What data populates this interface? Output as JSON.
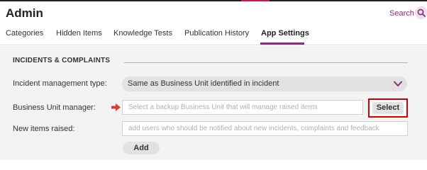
{
  "app": {
    "title": "Admin"
  },
  "header": {
    "search_label": "Search"
  },
  "tabs": [
    {
      "label": "Categories"
    },
    {
      "label": "Hidden Items"
    },
    {
      "label": "Knowledge Tests"
    },
    {
      "label": "Publication History"
    },
    {
      "label": "App Settings",
      "active": true
    }
  ],
  "section": {
    "title": "INCIDENTS & COMPLAINTS"
  },
  "fields": {
    "incident_type": {
      "label": "Incident management type:",
      "value": "Same as Business Unit identified in incident"
    },
    "bu_manager": {
      "label": "Business Unit manager:",
      "placeholder": "Select a backup Business Unit that will manage raised items",
      "button": "Select"
    },
    "new_items": {
      "label": "New items raised:",
      "placeholder": "add users who should be notified about new incidents, complaints and feedback",
      "button": "Add"
    }
  },
  "colors": {
    "accent": "#8e2a7d",
    "highlight": "#d40000",
    "arrow": "#e53935"
  }
}
